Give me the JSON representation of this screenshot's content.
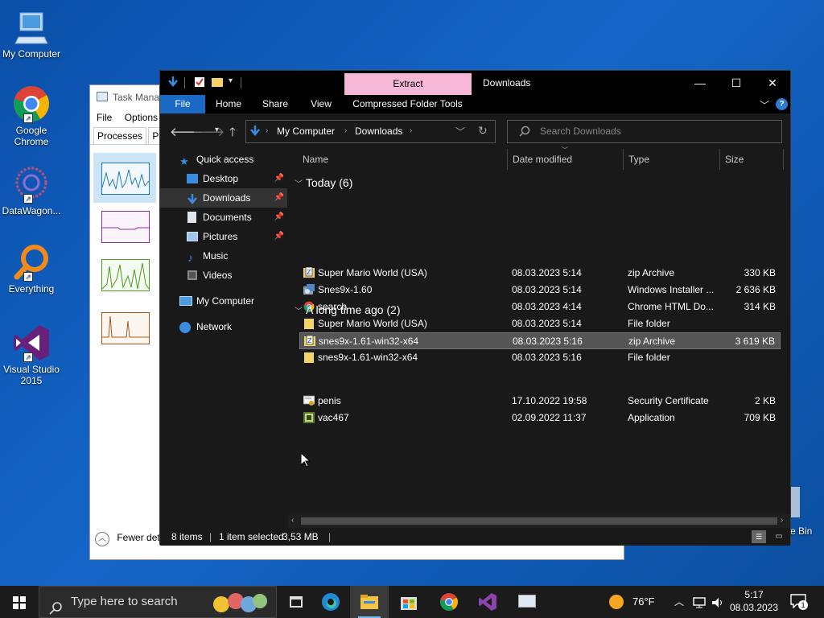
{
  "desktop": {
    "icons": [
      {
        "label": "My Computer"
      },
      {
        "label": "Google Chrome"
      },
      {
        "label": "DataWagon..."
      },
      {
        "label": "Everything"
      },
      {
        "label": "Visual Studio 2015"
      },
      {
        "label": "e Bin"
      }
    ]
  },
  "task_manager": {
    "title": "Task Manag",
    "menu": [
      "File",
      "Options"
    ],
    "tabs": [
      "Processes",
      "Pe"
    ],
    "footer": "Fewer det"
  },
  "explorer": {
    "context_tab": "Extract",
    "title": "Downloads",
    "ribbon_tabs": [
      "File",
      "Home",
      "Share",
      "View",
      "Compressed Folder Tools"
    ],
    "address": [
      "My Computer",
      "Downloads"
    ],
    "search_placeholder": "Search Downloads",
    "sidebar": [
      {
        "label": "Quick access",
        "icon": "star-icon"
      },
      {
        "label": "Desktop",
        "icon": "desktop-folder-icon",
        "pinned": true
      },
      {
        "label": "Downloads",
        "icon": "download-arrow-icon",
        "pinned": true,
        "selected": true
      },
      {
        "label": "Documents",
        "icon": "document-icon",
        "pinned": true
      },
      {
        "label": "Pictures",
        "icon": "picture-icon",
        "pinned": true
      },
      {
        "label": "Music",
        "icon": "music-note-icon"
      },
      {
        "label": "Videos",
        "icon": "video-icon"
      },
      {
        "label": "My Computer",
        "icon": "computer-icon"
      },
      {
        "label": "Network",
        "icon": "network-icon"
      }
    ],
    "columns": [
      "Name",
      "Date modified",
      "Type",
      "Size"
    ],
    "groups": [
      {
        "label": "Today (6)",
        "files": [
          {
            "name": "Super Mario World (USA)",
            "date": "08.03.2023 5:14",
            "type": "zip Archive",
            "size": "330 KB",
            "icon": "zip-icon"
          },
          {
            "name": "Snes9x-1.60",
            "date": "08.03.2023 5:14",
            "type": "Windows Installer ...",
            "size": "2 636 KB",
            "icon": "installer-icon"
          },
          {
            "name": "search",
            "date": "08.03.2023 4:14",
            "type": "Chrome HTML Do...",
            "size": "314 KB",
            "icon": "chrome-icon"
          },
          {
            "name": "Super Mario World (USA)",
            "date": "08.03.2023 5:14",
            "type": "File folder",
            "size": "",
            "icon": "folder-icon"
          },
          {
            "name": "snes9x-1.61-win32-x64",
            "date": "08.03.2023 5:16",
            "type": "zip Archive",
            "size": "3 619 KB",
            "icon": "zip-icon",
            "selected": true
          },
          {
            "name": "snes9x-1.61-win32-x64",
            "date": "08.03.2023 5:16",
            "type": "File folder",
            "size": "",
            "icon": "folder-icon"
          }
        ]
      },
      {
        "label": "A long time ago (2)",
        "files": [
          {
            "name": "penis",
            "date": "17.10.2022 19:58",
            "type": "Security Certificate",
            "size": "2 KB",
            "icon": "certificate-icon"
          },
          {
            "name": "vac467",
            "date": "02.09.2022 11:37",
            "type": "Application",
            "size": "709 KB",
            "icon": "application-icon"
          }
        ]
      }
    ],
    "status": {
      "items": "8 items",
      "selected": "1 item selected",
      "size": "3,53 MB"
    }
  },
  "taskbar": {
    "search_placeholder": "Type here to search",
    "weather": "76°F",
    "time": "5:17",
    "date": "08.03.2023",
    "notifications": "1"
  },
  "colors": {
    "accent": "#1a69c4",
    "context_tab": "#f6b8d6",
    "selection": "#555555"
  }
}
